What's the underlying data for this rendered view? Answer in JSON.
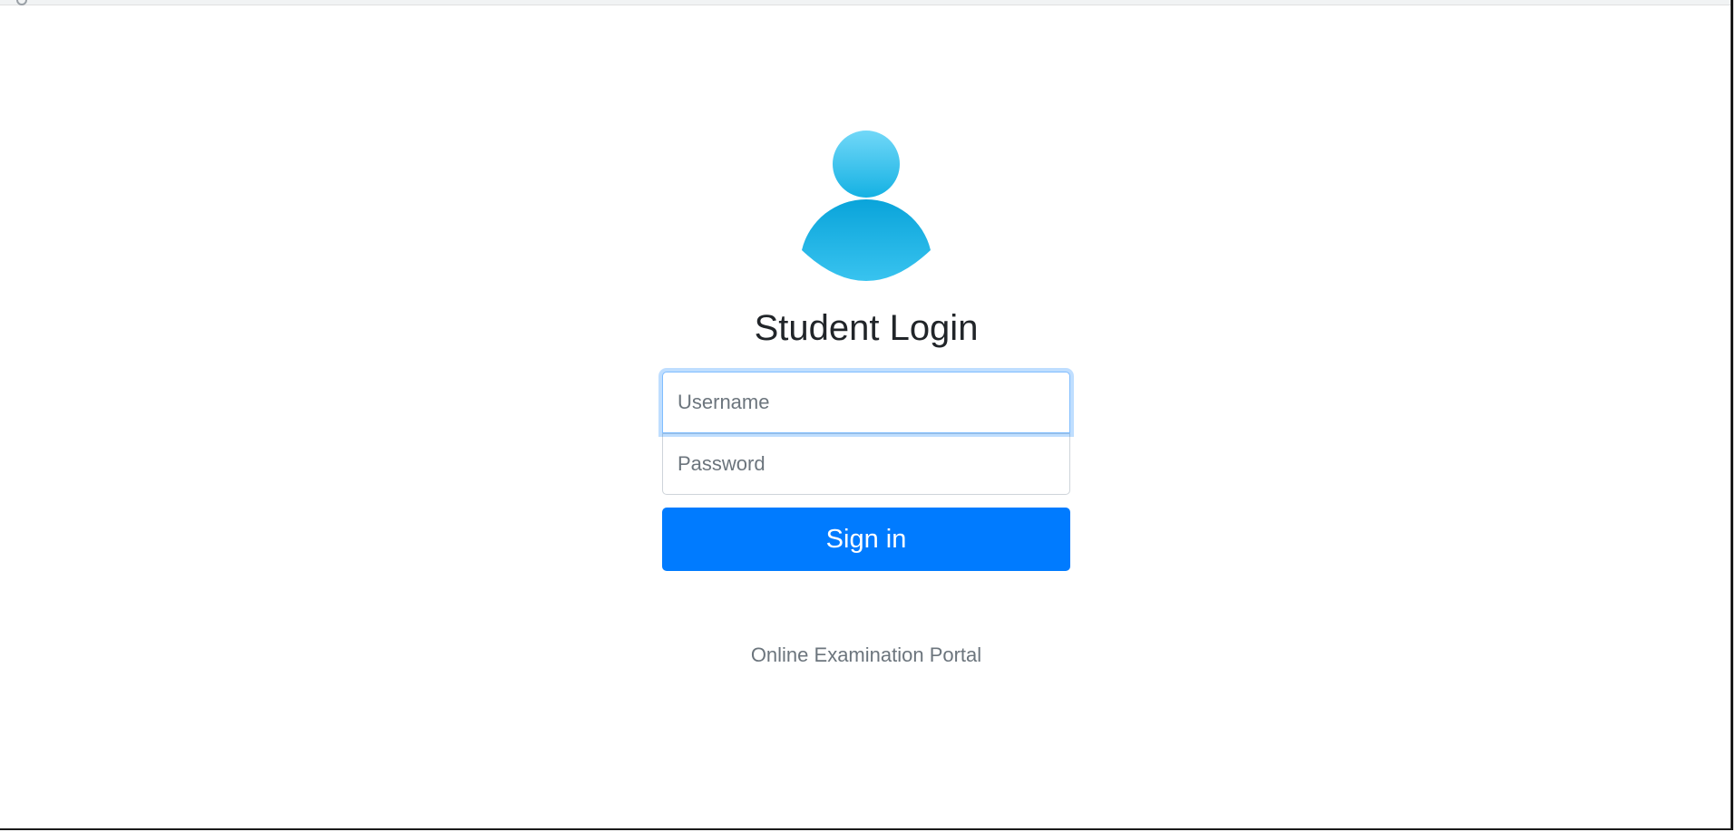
{
  "login": {
    "title": "Student Login",
    "username_placeholder": "Username",
    "password_placeholder": "Password",
    "signin_label": "Sign in",
    "footer": "Online Examination Portal"
  },
  "icons": {
    "avatar": "user-icon"
  },
  "colors": {
    "primary": "#007bff",
    "avatar_light": "#6fd6f7",
    "avatar_dark": "#0ea7dc",
    "title": "#212529",
    "muted": "#6c757d",
    "focus_border": "#80bdff"
  }
}
